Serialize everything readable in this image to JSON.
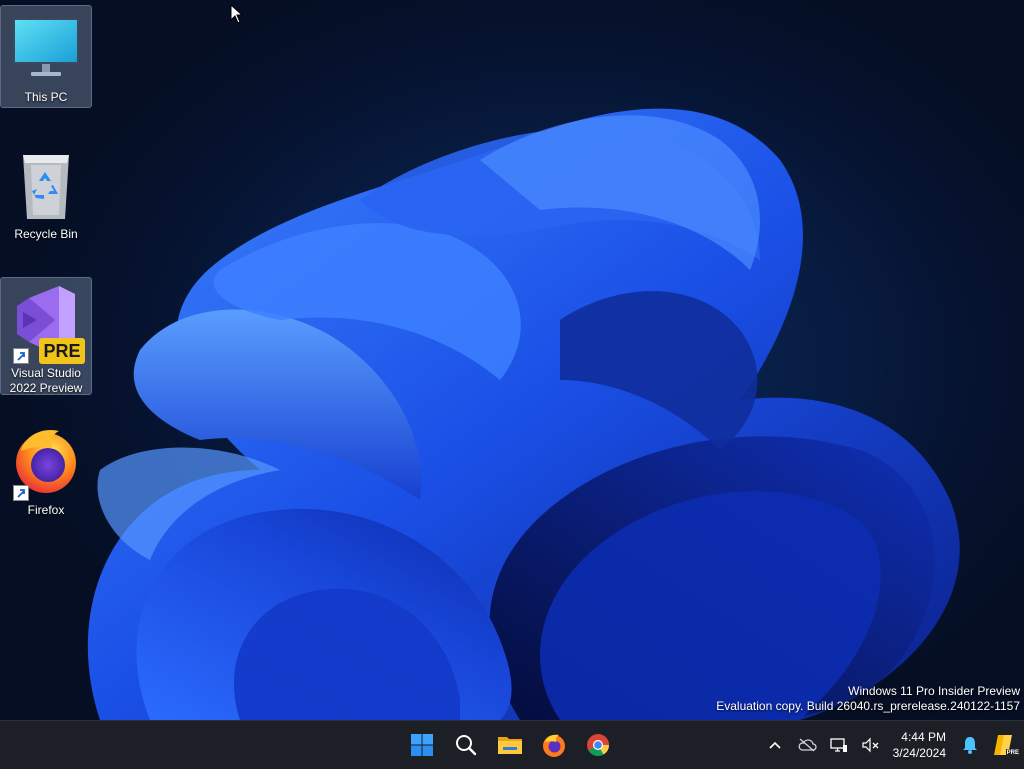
{
  "desktop": {
    "icons": [
      {
        "label": "This PC",
        "selected": true
      },
      {
        "label": "Recycle Bin",
        "selected": false
      },
      {
        "label": "Visual Studio\n2022 Preview",
        "badge": "PRE",
        "selected": true
      },
      {
        "label": "Firefox",
        "selected": false
      }
    ],
    "watermark": {
      "line1": "Windows 11 Pro Insider Preview",
      "line2": "Evaluation copy. Build 26040.rs_prerelease.240122-1157"
    }
  },
  "taskbar": {
    "pinned": [
      "start-icon",
      "search-icon",
      "file-explorer-icon",
      "firefox-icon",
      "chrome-icon"
    ],
    "tray": [
      "chevron-up-icon",
      "onedrive-icon",
      "network-icon",
      "volume-muted-icon",
      "notification-bell-icon",
      "copilot-icon"
    ],
    "tray_badge": "PRE",
    "clock": {
      "time": "4:44 PM",
      "date": "3/24/2024"
    }
  },
  "colors": {
    "accent": "#1f5cff",
    "taskbar_bg": "#1c1f26",
    "wallpaper_dark": "#061330"
  }
}
